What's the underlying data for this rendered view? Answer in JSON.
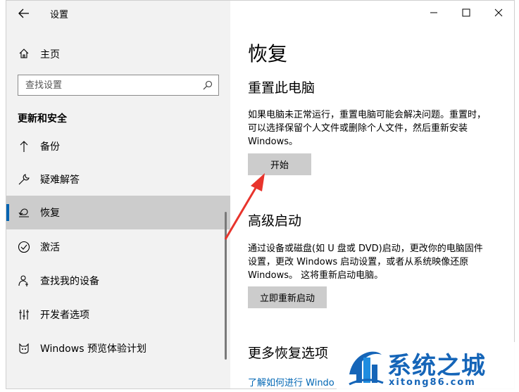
{
  "window": {
    "title": "设置",
    "controls": [
      "minimize",
      "maximize",
      "close"
    ]
  },
  "sidebar": {
    "home_label": "主页",
    "search": {
      "placeholder": "查找设置"
    },
    "section_heading": "更新和安全",
    "items": [
      {
        "label": "备份",
        "icon": "backup-arrow-icon",
        "selected": false
      },
      {
        "label": "疑难解答",
        "icon": "wrench-icon",
        "selected": false
      },
      {
        "label": "恢复",
        "icon": "recovery-icon",
        "selected": true
      },
      {
        "label": "激活",
        "icon": "check-circle-icon",
        "selected": false
      },
      {
        "label": "查找我的设备",
        "icon": "person-pin-icon",
        "selected": false
      },
      {
        "label": "开发者选项",
        "icon": "developer-tools-icon",
        "selected": false
      },
      {
        "label": "Windows 预览体验计划",
        "icon": "insider-cat-icon",
        "selected": false
      }
    ]
  },
  "main": {
    "page_title": "恢复",
    "reset": {
      "heading": "重置此电脑",
      "description": "如果电脑未正常运行，重置电脑可能会解决问题。重置时，可以选择保留个人文件或删除个人文件，然后重新安装 Windows。",
      "button_label": "开始"
    },
    "advanced": {
      "heading": "高级启动",
      "description": "通过设备或磁盘(如 U 盘或 DVD)启动，更改你的电脑固件设置，更改 Windows 启动设置，或者从系统映像还原 Windows。 这将重新启动电脑。",
      "button_label": "立即重新启动"
    },
    "more": {
      "heading": "更多恢复选项",
      "link_label": "了解如何进行 Windo"
    }
  },
  "annotation": {
    "arrow_color": "#e8342c"
  },
  "watermark": {
    "title": "系统之城",
    "url": "xitong86.com",
    "color": "#1565b8"
  },
  "colors": {
    "sidebar_bg": "#f2f2f2",
    "selected_bg": "#cccccc",
    "accent": "#0063b1",
    "button_bg": "#cccccc",
    "link": "#0066b4"
  }
}
